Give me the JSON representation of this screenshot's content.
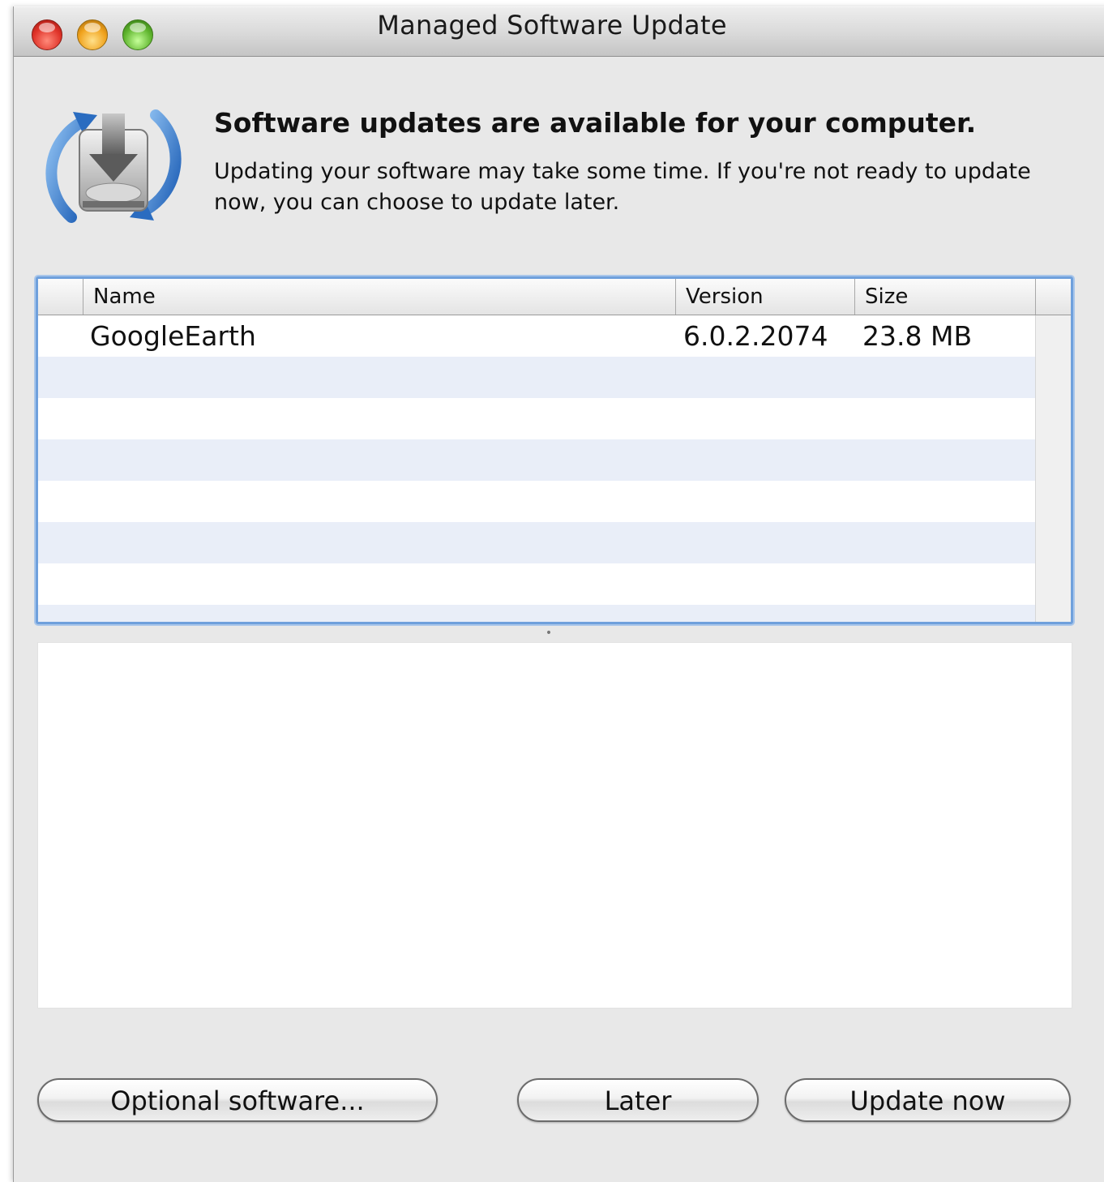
{
  "window": {
    "title": "Managed Software Update"
  },
  "header": {
    "icon": "software-update-icon",
    "headline": "Software updates are available for your computer.",
    "description": "Updating your software may take some time. If you're not ready to update now, you can choose to update later."
  },
  "table": {
    "columns": {
      "name": "Name",
      "version": "Version",
      "size": "Size"
    },
    "rows": [
      {
        "name": "GoogleEarth",
        "version": "6.0.2.2074",
        "size": "23.8 MB"
      }
    ]
  },
  "buttons": {
    "optional": "Optional software...",
    "later": "Later",
    "update": "Update now"
  },
  "colors": {
    "selection_border": "#6fa0dc",
    "alt_row": "#e9eef8",
    "window_bg": "#e8e8e8"
  }
}
